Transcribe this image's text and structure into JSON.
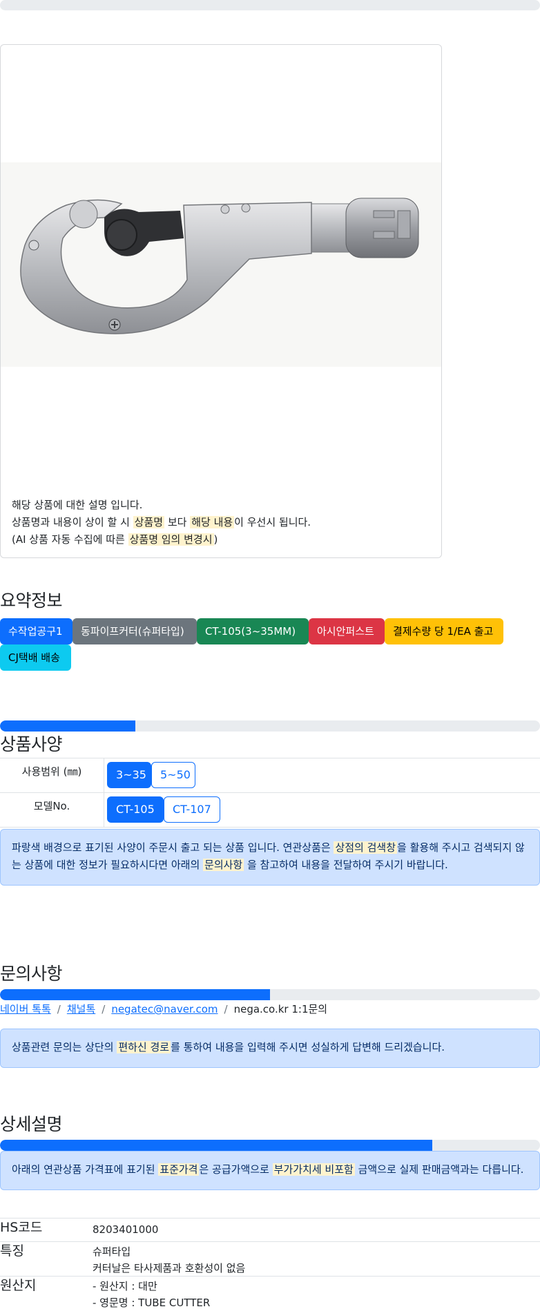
{
  "card": {
    "desc_line1": "해당 상품에 대한 설명 입니다.",
    "desc_line2_a": "상품명과 내용이 상이 할 시 ",
    "desc_line2_hl1": "상품명",
    "desc_line2_b": " 보다 ",
    "desc_line2_hl2": "해당 내용",
    "desc_line2_c": "이 우선시 됩니다.",
    "desc_line3_a": "(AI 상품 자동 수집에 따른 ",
    "desc_line3_hl": "상품명 임의 변경시",
    "desc_line3_b": ")"
  },
  "summary": {
    "title": "요약정보",
    "badges": [
      {
        "label": "수작업공구1",
        "color": "#0d6efd"
      },
      {
        "label": "동파이프커터(슈퍼타입)",
        "color": "#6c757d"
      },
      {
        "label": "CT-105(3~35MM)",
        "color": "#198754"
      },
      {
        "label": "아시안퍼스트",
        "color": "#dc3545"
      },
      {
        "label": "결제수량 당 1/EA 출고",
        "color": "#ffc107"
      },
      {
        "label": "CJ택배 배송",
        "color": "#0dcaf0"
      }
    ],
    "progress": 0.25
  },
  "spec": {
    "title": "상품사양",
    "rows": [
      {
        "label": "사용범위 (㎜)",
        "options": [
          "3~35",
          "5~50"
        ],
        "selected": 0
      },
      {
        "label": "모델No.",
        "options": [
          "CT-105",
          "CT-107"
        ],
        "selected": 0
      }
    ],
    "notice_a": "파랑색 배경으로 표기된 사양이 주문시 출고 되는 상품 입니다. 연관상품은 ",
    "notice_hl1": "상점의 검색창",
    "notice_b": "을 활용해 주시고 검색되지 않는 상품에 대한 정보가 필요하시다면 아래의 ",
    "notice_hl2": "문의사항",
    "notice_c": " 을 참고하여 내용을 전달하여 주시기 바랍니다."
  },
  "inquiry": {
    "title": "문의사항",
    "progress": 0.5,
    "links": [
      "네이버 톡톡",
      "채널톡",
      "negatec@naver.com"
    ],
    "link_text": "nega.co.kr 1:1문의",
    "notice_a": "상품관련 문의는 상단의 ",
    "notice_hl": "편하신 경로",
    "notice_b": "를 통하여 내용을 입력해 주시면 성실하게 답변해 드리겠습니다."
  },
  "detail": {
    "title": "상세설명",
    "progress": 0.8,
    "notice_a": "아래의 연관상품 가격표에 표기된 ",
    "notice_hl1": "표준가격",
    "notice_b": "은 공급가액으로 ",
    "notice_hl2": "부가가치세 비포함",
    "notice_c": " 금액으로 실제 판매금액과는 다릅니다.",
    "info": [
      {
        "label": "HS코드",
        "values": [
          "8203401000"
        ]
      },
      {
        "label": "특징",
        "values": [
          "슈퍼타입",
          "커터날은 타사제품과 호환성이 없음"
        ]
      },
      {
        "label": "원산지",
        "values": [
          "- 원산지 : 대만",
          "- 영문명 : TUBE CUTTER"
        ]
      }
    ]
  }
}
